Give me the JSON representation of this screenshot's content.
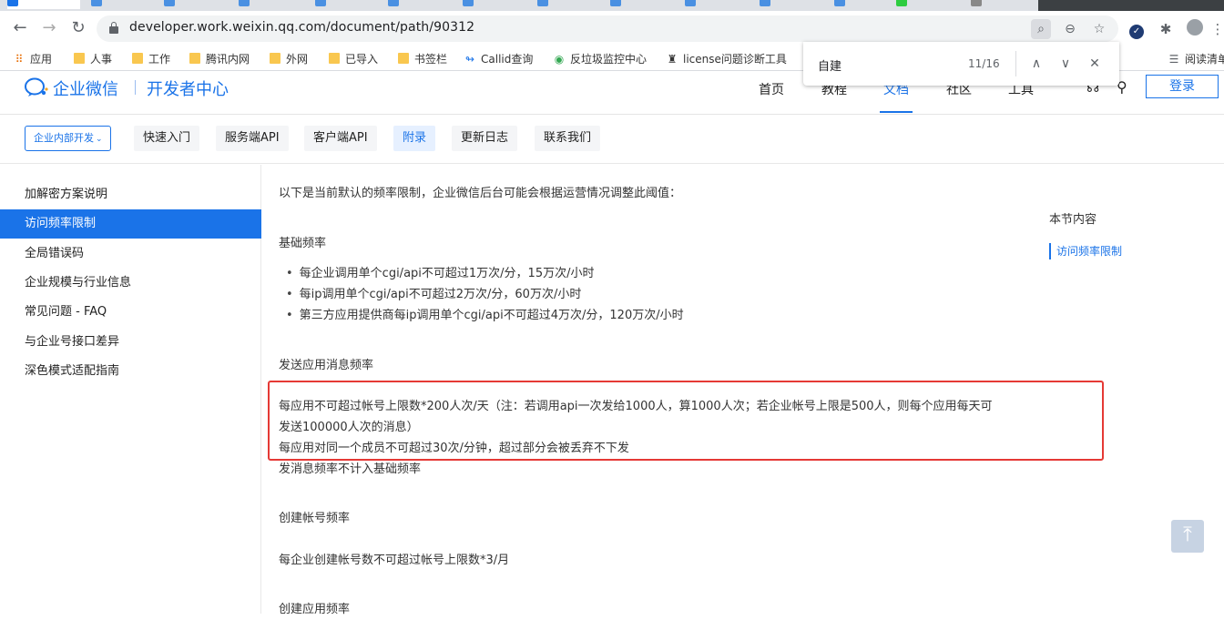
{
  "browser": {
    "url": "developer.work.weixin.qq.com/document/path/90312"
  },
  "bookmarks": [
    {
      "label": "应用",
      "icon": "apps-grid-icon"
    },
    {
      "label": "人事",
      "icon": "folder-icon"
    },
    {
      "label": "工作",
      "icon": "folder-icon"
    },
    {
      "label": "腾讯内网",
      "icon": "folder-icon"
    },
    {
      "label": "外网",
      "icon": "folder-icon"
    },
    {
      "label": "已导入",
      "icon": "folder-icon"
    },
    {
      "label": "书签栏",
      "icon": "folder-icon"
    },
    {
      "label": "Callid查询",
      "icon": "link-icon"
    },
    {
      "label": "反垃圾监控中心",
      "icon": "chrome-icon"
    },
    {
      "label": "license问题诊断工具",
      "icon": "tool-icon"
    }
  ],
  "reading_list": "阅读清单",
  "findbar": {
    "query": "自建",
    "count": "11/16"
  },
  "site": {
    "logo_text": "企业微信",
    "logo_sub": "开发者中心",
    "nav": [
      "首页",
      "教程",
      "文档",
      "社区",
      "工具"
    ],
    "active_nav": "文档",
    "login": "登录"
  },
  "subnav": {
    "dev_select": "企业内部开发",
    "tabs": [
      "快速入门",
      "服务端API",
      "客户端API",
      "附录",
      "更新日志",
      "联系我们"
    ],
    "active_tab": "附录"
  },
  "sidebar": {
    "items": [
      "加解密方案说明",
      "访问频率限制",
      "全局错误码",
      "企业规模与行业信息",
      "常见问题 - FAQ",
      "与企业号接口差异",
      "深色模式适配指南"
    ],
    "active": "访问频率限制"
  },
  "content": {
    "intro": "以下是当前默认的频率限制，企业微信后台可能会根据运营情况调整此阈值：",
    "basic_title": "基础频率",
    "basic_items": [
      "每企业调用单个cgi/api不可超过1万次/分，15万次/小时",
      "每ip调用单个cgi/api不可超过2万次/分，60万次/小时",
      "第三方应用提供商每ip调用单个cgi/api不可超过4万次/分，120万次/小时"
    ],
    "msg_title": "发送应用消息频率",
    "msg_line1": "每应用不可超过帐号上限数*200人次/天（注：若调用api一次发给1000人，算1000人次；若企业帐号上限是500人，则每个应用每天可",
    "msg_line2": "发送100000人次的消息）",
    "msg_line3": "每应用对同一个成员不可超过30次/分钟，超过部分会被丢弃不下发",
    "msg_line4": "发消息频率不计入基础频率",
    "acct_title": "创建帐号频率",
    "acct_line": "每企业创建帐号数不可超过帐号上限数*3/月",
    "app_title": "创建应用频率"
  },
  "toc": {
    "title": "本节内容",
    "link": "访问频率限制"
  }
}
